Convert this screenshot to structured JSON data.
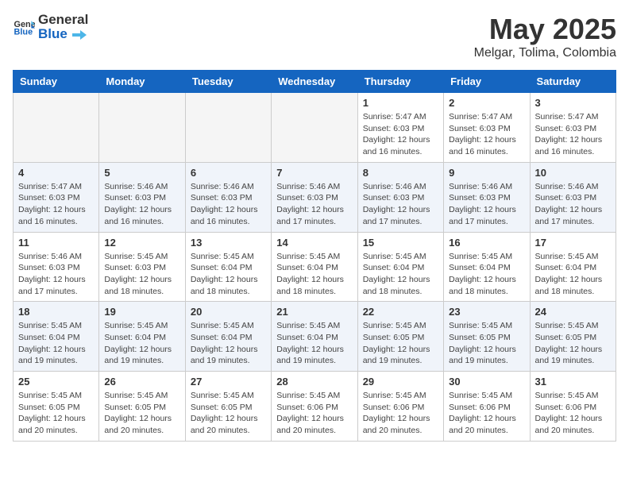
{
  "header": {
    "logo_general": "General",
    "logo_blue": "Blue",
    "title": "May 2025",
    "subtitle": "Melgar, Tolima, Colombia"
  },
  "days_of_week": [
    "Sunday",
    "Monday",
    "Tuesday",
    "Wednesday",
    "Thursday",
    "Friday",
    "Saturday"
  ],
  "weeks": [
    {
      "days": [
        {
          "num": "",
          "info": ""
        },
        {
          "num": "",
          "info": ""
        },
        {
          "num": "",
          "info": ""
        },
        {
          "num": "",
          "info": ""
        },
        {
          "num": "1",
          "info": "Sunrise: 5:47 AM\nSunset: 6:03 PM\nDaylight: 12 hours\nand 16 minutes."
        },
        {
          "num": "2",
          "info": "Sunrise: 5:47 AM\nSunset: 6:03 PM\nDaylight: 12 hours\nand 16 minutes."
        },
        {
          "num": "3",
          "info": "Sunrise: 5:47 AM\nSunset: 6:03 PM\nDaylight: 12 hours\nand 16 minutes."
        }
      ]
    },
    {
      "days": [
        {
          "num": "4",
          "info": "Sunrise: 5:47 AM\nSunset: 6:03 PM\nDaylight: 12 hours\nand 16 minutes."
        },
        {
          "num": "5",
          "info": "Sunrise: 5:46 AM\nSunset: 6:03 PM\nDaylight: 12 hours\nand 16 minutes."
        },
        {
          "num": "6",
          "info": "Sunrise: 5:46 AM\nSunset: 6:03 PM\nDaylight: 12 hours\nand 16 minutes."
        },
        {
          "num": "7",
          "info": "Sunrise: 5:46 AM\nSunset: 6:03 PM\nDaylight: 12 hours\nand 17 minutes."
        },
        {
          "num": "8",
          "info": "Sunrise: 5:46 AM\nSunset: 6:03 PM\nDaylight: 12 hours\nand 17 minutes."
        },
        {
          "num": "9",
          "info": "Sunrise: 5:46 AM\nSunset: 6:03 PM\nDaylight: 12 hours\nand 17 minutes."
        },
        {
          "num": "10",
          "info": "Sunrise: 5:46 AM\nSunset: 6:03 PM\nDaylight: 12 hours\nand 17 minutes."
        }
      ]
    },
    {
      "days": [
        {
          "num": "11",
          "info": "Sunrise: 5:46 AM\nSunset: 6:03 PM\nDaylight: 12 hours\nand 17 minutes."
        },
        {
          "num": "12",
          "info": "Sunrise: 5:45 AM\nSunset: 6:03 PM\nDaylight: 12 hours\nand 18 minutes."
        },
        {
          "num": "13",
          "info": "Sunrise: 5:45 AM\nSunset: 6:04 PM\nDaylight: 12 hours\nand 18 minutes."
        },
        {
          "num": "14",
          "info": "Sunrise: 5:45 AM\nSunset: 6:04 PM\nDaylight: 12 hours\nand 18 minutes."
        },
        {
          "num": "15",
          "info": "Sunrise: 5:45 AM\nSunset: 6:04 PM\nDaylight: 12 hours\nand 18 minutes."
        },
        {
          "num": "16",
          "info": "Sunrise: 5:45 AM\nSunset: 6:04 PM\nDaylight: 12 hours\nand 18 minutes."
        },
        {
          "num": "17",
          "info": "Sunrise: 5:45 AM\nSunset: 6:04 PM\nDaylight: 12 hours\nand 18 minutes."
        }
      ]
    },
    {
      "days": [
        {
          "num": "18",
          "info": "Sunrise: 5:45 AM\nSunset: 6:04 PM\nDaylight: 12 hours\nand 19 minutes."
        },
        {
          "num": "19",
          "info": "Sunrise: 5:45 AM\nSunset: 6:04 PM\nDaylight: 12 hours\nand 19 minutes."
        },
        {
          "num": "20",
          "info": "Sunrise: 5:45 AM\nSunset: 6:04 PM\nDaylight: 12 hours\nand 19 minutes."
        },
        {
          "num": "21",
          "info": "Sunrise: 5:45 AM\nSunset: 6:04 PM\nDaylight: 12 hours\nand 19 minutes."
        },
        {
          "num": "22",
          "info": "Sunrise: 5:45 AM\nSunset: 6:05 PM\nDaylight: 12 hours\nand 19 minutes."
        },
        {
          "num": "23",
          "info": "Sunrise: 5:45 AM\nSunset: 6:05 PM\nDaylight: 12 hours\nand 19 minutes."
        },
        {
          "num": "24",
          "info": "Sunrise: 5:45 AM\nSunset: 6:05 PM\nDaylight: 12 hours\nand 19 minutes."
        }
      ]
    },
    {
      "days": [
        {
          "num": "25",
          "info": "Sunrise: 5:45 AM\nSunset: 6:05 PM\nDaylight: 12 hours\nand 20 minutes."
        },
        {
          "num": "26",
          "info": "Sunrise: 5:45 AM\nSunset: 6:05 PM\nDaylight: 12 hours\nand 20 minutes."
        },
        {
          "num": "27",
          "info": "Sunrise: 5:45 AM\nSunset: 6:05 PM\nDaylight: 12 hours\nand 20 minutes."
        },
        {
          "num": "28",
          "info": "Sunrise: 5:45 AM\nSunset: 6:06 PM\nDaylight: 12 hours\nand 20 minutes."
        },
        {
          "num": "29",
          "info": "Sunrise: 5:45 AM\nSunset: 6:06 PM\nDaylight: 12 hours\nand 20 minutes."
        },
        {
          "num": "30",
          "info": "Sunrise: 5:45 AM\nSunset: 6:06 PM\nDaylight: 12 hours\nand 20 minutes."
        },
        {
          "num": "31",
          "info": "Sunrise: 5:45 AM\nSunset: 6:06 PM\nDaylight: 12 hours\nand 20 minutes."
        }
      ]
    }
  ]
}
